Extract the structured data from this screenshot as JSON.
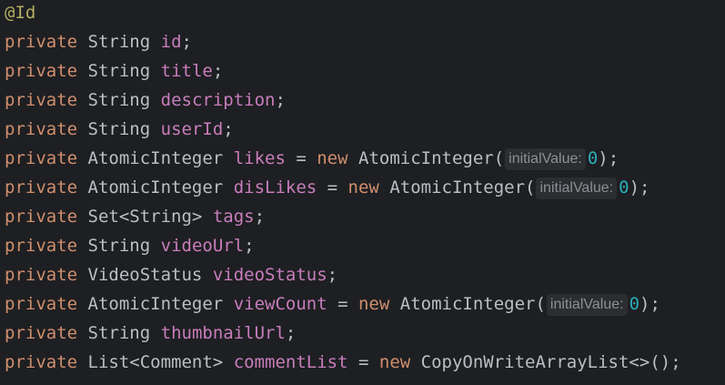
{
  "lines": [
    {
      "annotation": "@Id"
    },
    {
      "modifier": "private",
      "type": "String",
      "name": "id",
      "end": ";"
    },
    {
      "modifier": "private",
      "type": "String",
      "name": "title",
      "end": ";"
    },
    {
      "modifier": "private",
      "type": "String",
      "name": "description",
      "end": ";"
    },
    {
      "modifier": "private",
      "type": "String",
      "name": "userId",
      "end": ";"
    },
    {
      "modifier": "private",
      "type": "AtomicInteger",
      "name": "likes",
      "assign": " = ",
      "new_kw": "new",
      "ctor": "AtomicInteger(",
      "hint": "initialValue:",
      "arg": "0",
      "end": ");"
    },
    {
      "modifier": "private",
      "type": "AtomicInteger",
      "name": "disLikes",
      "assign": " = ",
      "new_kw": "new",
      "ctor": "AtomicInteger(",
      "hint": "initialValue:",
      "arg": "0",
      "end": ");"
    },
    {
      "modifier": "private",
      "type": "Set<String>",
      "name": "tags",
      "end": ";"
    },
    {
      "modifier": "private",
      "type": "String",
      "name": "videoUrl",
      "end": ";"
    },
    {
      "modifier": "private",
      "type": "VideoStatus",
      "name": "videoStatus",
      "end": ";"
    },
    {
      "modifier": "private",
      "type": "AtomicInteger",
      "name": "viewCount",
      "assign": " = ",
      "new_kw": "new",
      "ctor": "AtomicInteger(",
      "hint": "initialValue:",
      "arg": "0",
      "end": ");"
    },
    {
      "modifier": "private",
      "type": "String",
      "name": "thumbnailUrl",
      "end": ";"
    },
    {
      "modifier": "private",
      "type": "List<Comment>",
      "name": "commentList",
      "assign": " = ",
      "new_kw": "new",
      "ctor": "CopyOnWriteArrayList<>(",
      "end": ");"
    }
  ]
}
